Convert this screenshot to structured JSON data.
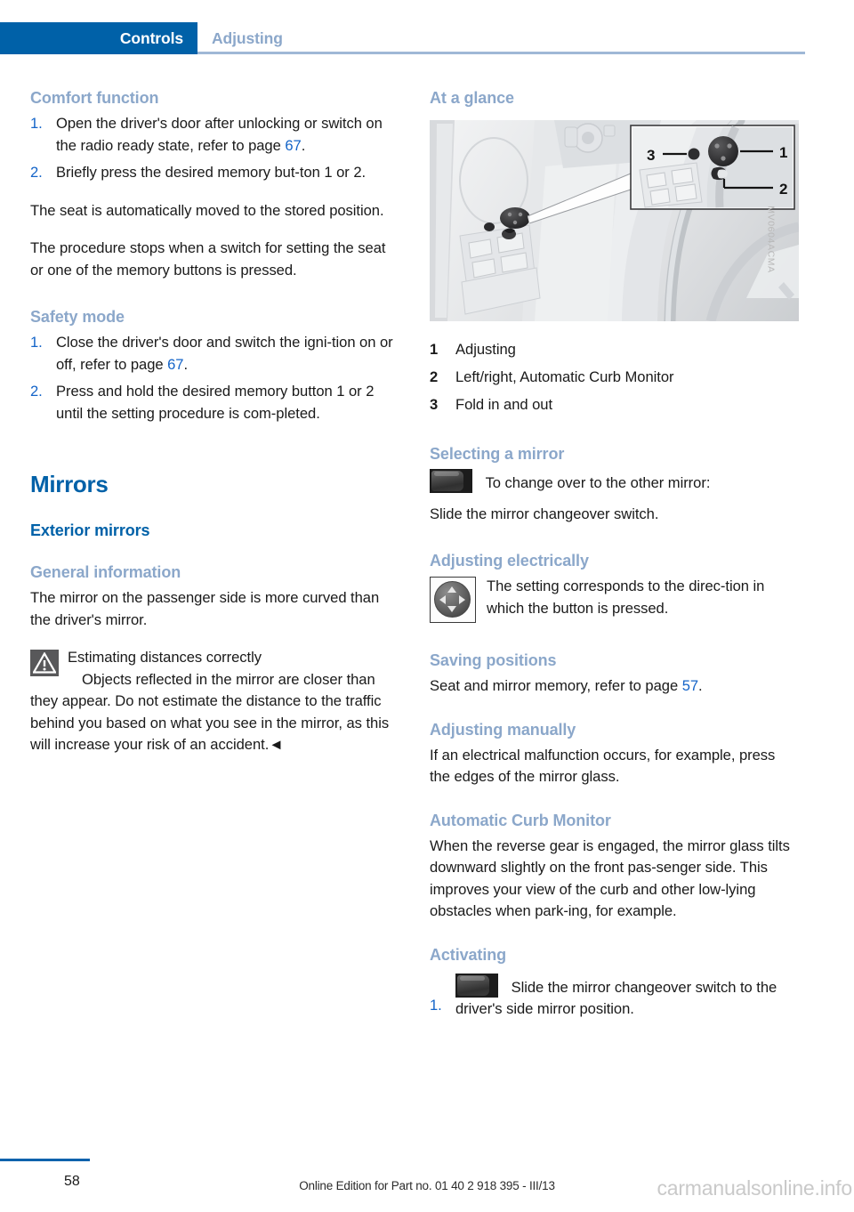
{
  "header": {
    "active_tab": "Controls",
    "inactive_tab": "Adjusting",
    "accent_blue": "#0061a8",
    "muted_blue": "#8ba7ca"
  },
  "left_column": {
    "comfort_function": {
      "heading": "Comfort function",
      "steps": [
        {
          "num": "1.",
          "text_before": "Open the driver's door after unlocking or switch on the radio ready state, refer to page ",
          "page_ref": "67",
          "text_after": "."
        },
        {
          "num": "2.",
          "text_before": "Briefly press the desired memory but-ton 1 or 2.",
          "page_ref": "",
          "text_after": ""
        }
      ],
      "paragraph_1": "The seat is automatically moved to the stored position.",
      "paragraph_2": "The procedure stops when a switch for setting the seat or one of the memory buttons is pressed."
    },
    "safety_mode": {
      "heading": "Safety mode",
      "steps": [
        {
          "num": "1.",
          "text_before": "Close the driver's door and switch the igni-tion on or off, refer to page ",
          "page_ref": "67",
          "text_after": "."
        },
        {
          "num": "2.",
          "text_before": "Press and hold the desired memory button 1 or 2 until the setting procedure is com-pleted.",
          "page_ref": "",
          "text_after": ""
        }
      ]
    },
    "mirrors": {
      "title": "Mirrors",
      "subtitle": "Exterior mirrors",
      "general_info_heading": "General information",
      "general_info_text": "The mirror on the passenger side is more curved than the driver's mirror.",
      "warning": {
        "title": "Estimating distances correctly",
        "body": "Objects reflected in the mirror are closer than they appear. Do not estimate the distance to the traffic behind you based on what you see in the mirror, as this will increase your risk of an accident.",
        "end_mark": "◄"
      }
    }
  },
  "right_column": {
    "at_a_glance": {
      "heading": "At a glance",
      "figure_code": "MV0604ACMA",
      "callouts": [
        {
          "num": "1",
          "label": "Adjusting"
        },
        {
          "num": "2",
          "label": "Left/right, Automatic Curb Monitor"
        },
        {
          "num": "3",
          "label": "Fold in and out"
        }
      ]
    },
    "selecting_a_mirror": {
      "heading": "Selecting a mirror",
      "icon_line": "To change over to the other mirror:",
      "body": "Slide the mirror changeover switch."
    },
    "adjusting_electrically": {
      "heading": "Adjusting electrically",
      "body": "The setting corresponds to the direc-tion in which the button is pressed."
    },
    "saving_positions": {
      "heading": "Saving positions",
      "text_before": "Seat and mirror memory, refer to page ",
      "page_ref": "57",
      "text_after": "."
    },
    "adjusting_manually": {
      "heading": "Adjusting manually",
      "body": "If an electrical malfunction occurs, for example, press the edges of the mirror glass."
    },
    "automatic_curb_monitor": {
      "heading": "Automatic Curb Monitor",
      "body": "When the reverse gear is engaged, the mirror glass tilts downward slightly on the front pas-senger side. This improves your view of the curb and other low-lying obstacles when park-ing, for example."
    },
    "activating": {
      "heading": "Activating",
      "step_num": "1.",
      "text": "Slide the mirror changeover switch to the driver's side mirror position."
    }
  },
  "footer": {
    "page_number": "58",
    "edition_text": "Online Edition for Part no. 01 40 2 918 395 - III/13",
    "watermark": "carmanualsonline.info"
  }
}
